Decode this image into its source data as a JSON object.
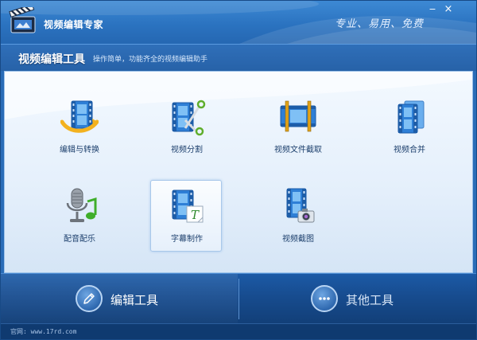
{
  "window": {
    "title": "视频编辑专家",
    "slogan": "专业、易用、免费",
    "minimize_glyph": "−",
    "close_glyph": "×"
  },
  "header": {
    "section_title": "视频编辑工具",
    "section_desc": "操作简单，功能齐全的视频编辑助手"
  },
  "tools": [
    {
      "label": "编辑与转换",
      "icon": "film-convert-icon"
    },
    {
      "label": "视频分割",
      "icon": "film-scissors-icon"
    },
    {
      "label": "视频文件截取",
      "icon": "film-cut-icon"
    },
    {
      "label": "视频合并",
      "icon": "film-merge-icon"
    },
    {
      "label": "配音配乐",
      "icon": "microphone-music-icon"
    },
    {
      "label": "字幕制作",
      "icon": "film-subtitle-icon",
      "selected": true
    },
    {
      "label": "视频截图",
      "icon": "film-camera-icon"
    }
  ],
  "nav": {
    "edit_tools": "编辑工具",
    "other_tools": "其他工具"
  },
  "status": {
    "website": "官网: www.17rd.com"
  },
  "colors": {
    "title_bar": "#2b73c0",
    "content_bg": "#e4effb",
    "bottom_bar": "#174c8f",
    "label_text": "#1c3f6c"
  }
}
